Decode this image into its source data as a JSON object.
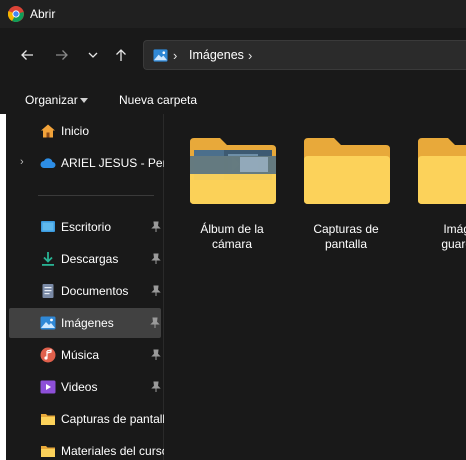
{
  "window": {
    "title": "Abrir"
  },
  "nav": {
    "back": "back-arrow-icon",
    "forward": "forward-arrow-icon",
    "recent": "chevron-down-icon",
    "up": "up-arrow-icon"
  },
  "address": {
    "segment": "Imágenes",
    "sep1": "›",
    "sep2": "›"
  },
  "toolbar": {
    "organize_label": "Organizar",
    "new_folder_label": "Nueva carpeta"
  },
  "sidebar": {
    "items": [
      {
        "label": "Inicio",
        "icon": "home-icon"
      },
      {
        "label": "ARIEL JESUS - Perso",
        "icon": "onedrive-cloud-icon"
      },
      {
        "label": "Escritorio",
        "icon": "desktop-icon",
        "pinned": true
      },
      {
        "label": "Descargas",
        "icon": "downloads-icon",
        "pinned": true
      },
      {
        "label": "Documentos",
        "icon": "documents-icon",
        "pinned": true
      },
      {
        "label": "Imágenes",
        "icon": "pictures-icon",
        "pinned": true,
        "selected": true
      },
      {
        "label": "Música",
        "icon": "music-icon",
        "pinned": true
      },
      {
        "label": "Videos",
        "icon": "videos-icon",
        "pinned": true
      },
      {
        "label": "Capturas de pantall",
        "icon": "folder-icon"
      },
      {
        "label": "Materiales del curso",
        "icon": "folder-icon"
      }
    ]
  },
  "folders": [
    {
      "line1": "Álbum de la",
      "line2": "cámara",
      "thumbnail": true
    },
    {
      "line1": "Capturas de",
      "line2": "pantalla",
      "thumbnail": false
    },
    {
      "line1": "Imáge",
      "line2": "guarda",
      "thumbnail": false
    }
  ],
  "colors": {
    "folder_back": "#e8a93a",
    "folder_front": "#fcd25a",
    "selection": "#414141",
    "background": "#191919"
  }
}
